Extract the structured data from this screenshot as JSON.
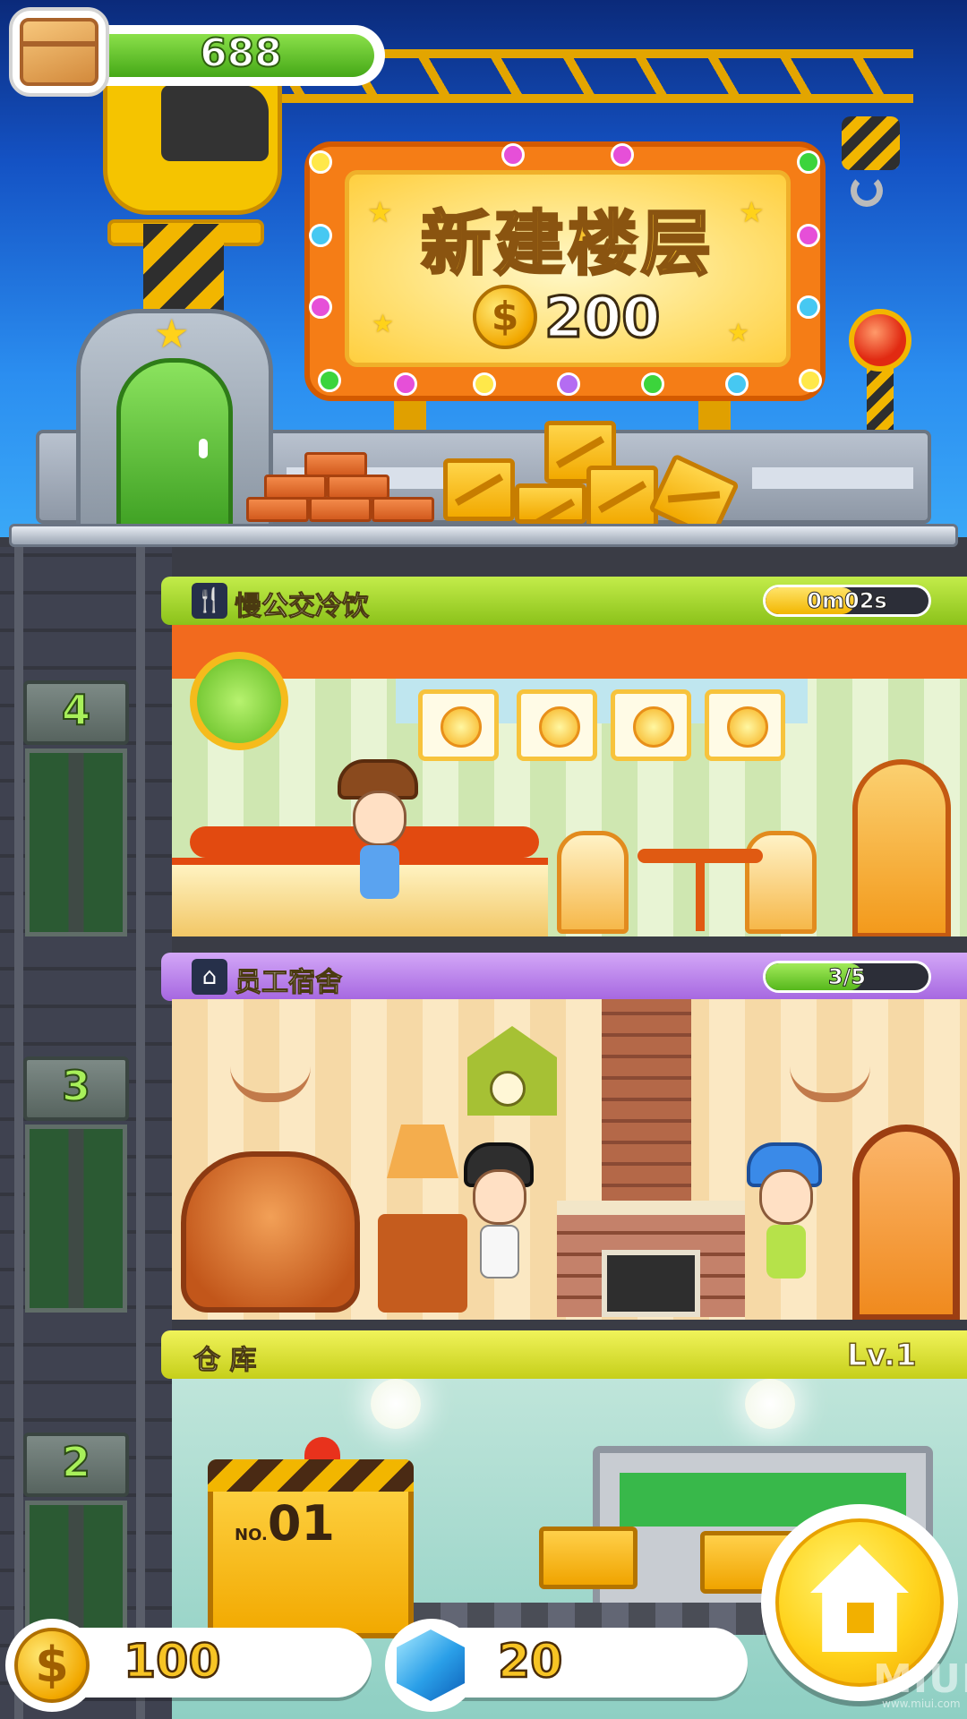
{
  "resources": {
    "boxes": "688",
    "coins": "100",
    "gems": "20"
  },
  "build_sign": {
    "title": "新建楼层",
    "price": "200",
    "coin_symbol": "$"
  },
  "floors": [
    {
      "number": "4",
      "title": "慢公交冷饮",
      "icon": "fork-knife-icon",
      "status": "0m02s",
      "status_progress": 0.55,
      "header_color": "#9bcf2a"
    },
    {
      "number": "3",
      "title": "员工宿舍",
      "icon": "house-icon",
      "status": "3/5",
      "status_progress": 0.6,
      "header_color": "#b67be6"
    },
    {
      "number": "2",
      "title": "仓 库",
      "status": "Lv.1",
      "header_color": "#cfd83a"
    }
  ],
  "warehouse": {
    "cargo_prefix": "NO.",
    "cargo_number": "01"
  },
  "watermark": {
    "brand": "MIUI",
    "url": "www.miui.com"
  },
  "colors": {
    "accent_green": "#45a817",
    "gold": "#f7c424",
    "gem_blue": "#2a9fe8"
  }
}
